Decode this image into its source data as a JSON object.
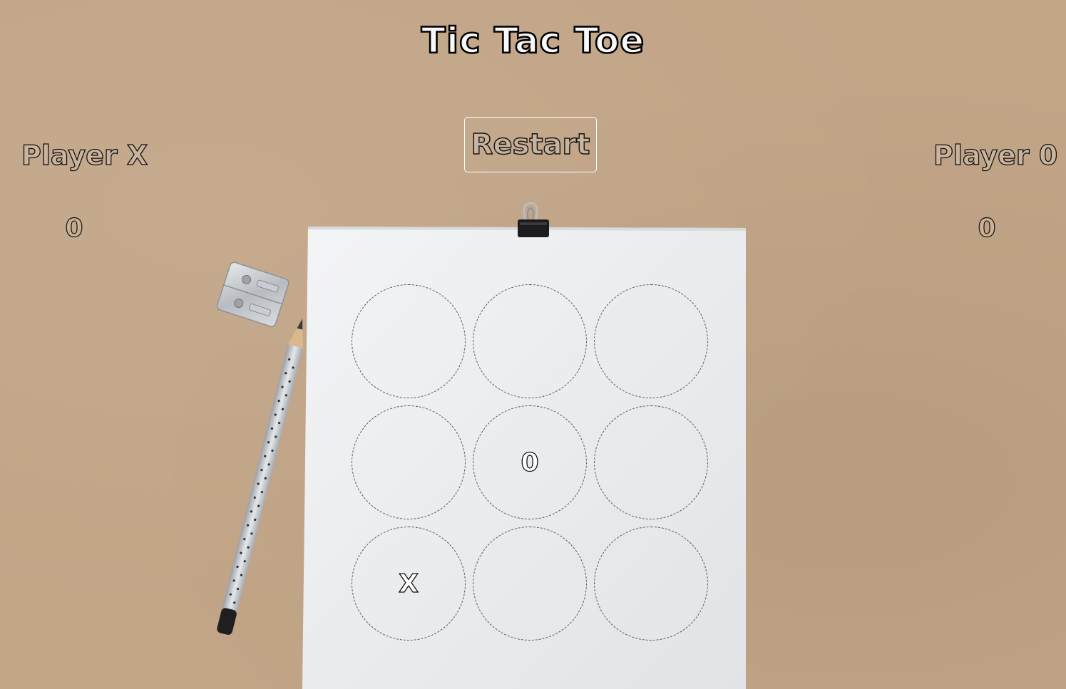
{
  "game": {
    "title": "Tic Tac Toe",
    "restart_label": "Restart"
  },
  "players": {
    "x": {
      "label": "Player X",
      "score": "0"
    },
    "o": {
      "label": "Player 0",
      "score": "0"
    }
  },
  "board": {
    "cells": [
      "",
      "",
      "",
      "",
      "0",
      "",
      "X",
      "",
      ""
    ]
  },
  "colors": {
    "background": "#c2a587",
    "paper": "#eef0f2",
    "outline": "#111111"
  }
}
